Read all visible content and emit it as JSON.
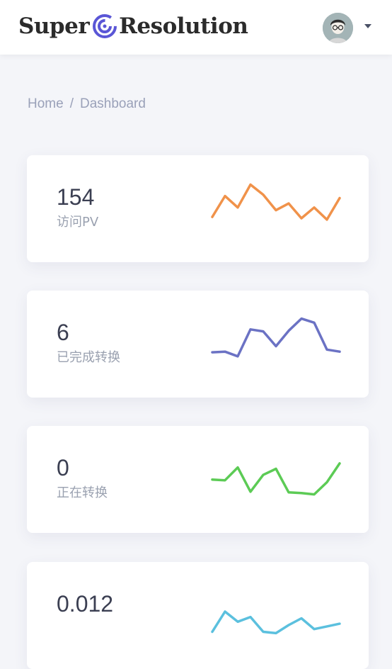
{
  "header": {
    "logo_left": "Super",
    "logo_right": "Resolution",
    "accent_color": "#5a56d6"
  },
  "breadcrumb": {
    "home": "Home",
    "separator": "/",
    "current": "Dashboard"
  },
  "cards": [
    {
      "value": "154",
      "label": "访问PV",
      "color": "#f0924a",
      "trend": [
        52,
        83,
        66,
        100,
        85,
        62,
        72,
        50,
        66,
        48,
        80
      ]
    },
    {
      "value": "6",
      "label": "已完成转换",
      "color": "#6b72c4",
      "trend": [
        52,
        53,
        46,
        86,
        83,
        61,
        84,
        102,
        96,
        56,
        53
      ]
    },
    {
      "value": "0",
      "label": "正在转换",
      "color": "#5ccb55",
      "trend": [
        64,
        63,
        82,
        46,
        71,
        80,
        45,
        44,
        42,
        60,
        88
      ]
    },
    {
      "value": "0.012",
      "label": "",
      "color": "#5bc0de",
      "trend": [
        40,
        70,
        55,
        62,
        40,
        38,
        50,
        60,
        44,
        48,
        52
      ]
    }
  ]
}
